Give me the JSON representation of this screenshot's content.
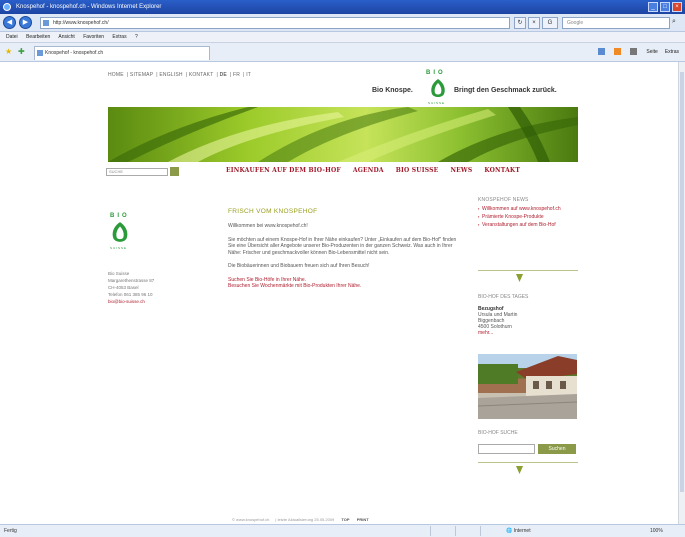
{
  "window": {
    "title": "Knospehof - knospehof.ch - Windows Internet Explorer"
  },
  "browser": {
    "url": "http://www.knospehof.ch/",
    "search_placeholder": "Google",
    "menu": [
      "Datei",
      "Bearbeiten",
      "Ansicht",
      "Favoriten",
      "Extras",
      "?"
    ],
    "tab_title": "Knospehof - knospehof.ch",
    "commands": [
      "Seite",
      "Extras"
    ],
    "status_left": "Fertig",
    "status_zone": "Internet",
    "zoom": "100%"
  },
  "site": {
    "topnav": [
      "HOME",
      "SITEMAP",
      "ENGLISH",
      "KONTAKT",
      "DE",
      "FR",
      "IT"
    ],
    "slogan_left": "Bio Knospe.",
    "slogan_right": "Bringt den Geschmack zurück.",
    "bio_logo_text": "BIO",
    "bio_logo_sub": "SUISSE",
    "search_placeholder": "SUCHE",
    "mainnav": [
      "EINKAUFEN AUF DEM BIO-HOF",
      "AGENDA",
      "BIO SUISSE",
      "NEWS",
      "KONTAKT"
    ],
    "address": [
      "Bio Suisse",
      "Margarethenstrasse 87",
      "CH-4053 Basel",
      "Telefon 061 385 96 10",
      "bio@bio-suisse.ch"
    ],
    "content": {
      "title": "FRISCH VOM KNOSPEHOF",
      "welcome": "Willkommen bei www.knospehof.ch!",
      "para1": "Sie möchten auf einem Knospe-Hof in Ihrer Nähe einkaufen? Unter „Einkaufen auf dem Bio-Hof\" finden Sie eine Übersicht aller Angebote unserer Bio-Produzenten in der ganzen Schweiz. Was auch in Ihrer Nähe: Frischer und geschmackvoller können Bio-Lebensmittel nicht sein.",
      "para2": "Die Biobäuerinnen und Biobauern freuen sich auf Ihren Besuch!",
      "link1": "Suchen Sie Bio-Höfe in Ihrer Nähe.",
      "link2": "Besuchen Sie Wochenmärkte mit Bio-Produkten Ihrer Nähe."
    },
    "news": {
      "title": "KNOSPEHOF NEWS",
      "items": [
        "Willkommen auf www.knospehof.ch",
        "Prämierte Knospe-Produkte",
        "Veranstaltungen auf dem Bio-Hof"
      ]
    },
    "hof": {
      "title": "BIO-HOF DES TAGES",
      "name": "Bezugshof",
      "lines": [
        "Ursula und Martin",
        "Biggenbach",
        "4500 Solothurn"
      ],
      "more": "mehr..."
    },
    "biosearch": {
      "title": "BIO-HOF SUCHE",
      "button": "Suchen"
    },
    "footer": [
      "© www.knospehof.ch",
      "letzte Aktualisierung 25.05.2009",
      "TOP",
      "PRINT"
    ]
  }
}
